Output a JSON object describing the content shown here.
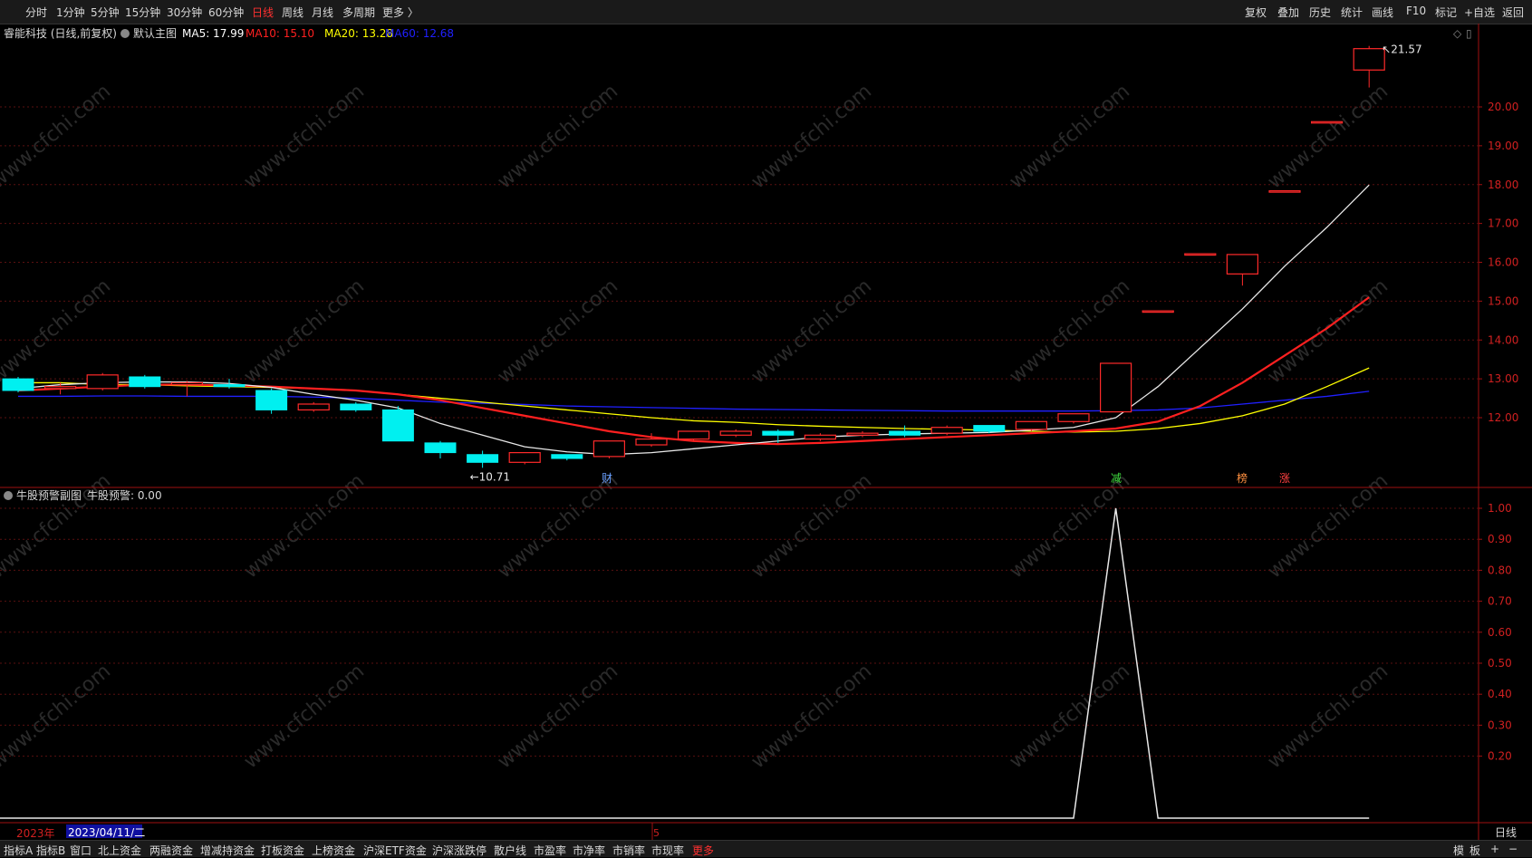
{
  "toolbar": {
    "left": [
      "分时",
      "1分钟",
      "5分钟",
      "15分钟",
      "30分钟",
      "60分钟",
      "日线",
      "周线",
      "月线",
      "多周期",
      "更多 〉"
    ],
    "active": "日线",
    "right": [
      "复权",
      "叠加",
      "历史",
      "统计",
      "画线",
      "F10",
      "标记",
      "+自选",
      "返回"
    ]
  },
  "main_chart": {
    "title": "睿能科技 (日线,前复权)",
    "formula": "默认主图",
    "ma": [
      {
        "label": "MA5: 17.99",
        "color": "#ffffff"
      },
      {
        "label": "MA10: 15.10",
        "color": "#ff2020"
      },
      {
        "label": "MA20: 13.28",
        "color": "#ffff00"
      },
      {
        "label": "MA60: 12.68",
        "color": "#2020ff"
      }
    ],
    "high_label": "21.57",
    "low_label": "10.71",
    "event_markers": [
      {
        "text": "财",
        "color": "#6aa0ff"
      },
      {
        "text": "减",
        "color": "#40e040"
      },
      {
        "text": "榜",
        "color": "#ff9040"
      },
      {
        "text": "涨",
        "color": "#ff4040"
      }
    ]
  },
  "sub_chart": {
    "title": "牛股预警副图",
    "value_label": "牛股预警: 0.00"
  },
  "timeline": {
    "year": "2023年",
    "cursor_date": "2023/04/11/二",
    "mid_label": "5"
  },
  "watermark": "www.cfchi.com",
  "period_label": "日线",
  "bottom": {
    "items": [
      "指标A",
      "指标B",
      "窗口",
      "北上资金",
      "两融资金",
      "增减持资金",
      "打板资金",
      "上榜资金",
      "沪深ETF资金",
      "沪深涨跌停",
      "散户线",
      "市盈率",
      "市净率",
      "市销率",
      "市现率",
      "更多"
    ],
    "right": [
      "模",
      "板",
      "+",
      "−"
    ]
  },
  "chart_data": [
    {
      "type": "candlestick",
      "title": "睿能科技 (日线,前复权)",
      "ylim": [
        11.0,
        22.0
      ],
      "yticks": [
        "20.00",
        "19.00",
        "18.00",
        "17.00",
        "16.00",
        "15.00",
        "14.00",
        "13.00",
        "12.00"
      ],
      "candles": [
        {
          "o": 12.7,
          "c": 13.0,
          "h": 13.05,
          "l": 12.65,
          "up": false
        },
        {
          "o": 12.75,
          "c": 12.8,
          "h": 12.9,
          "l": 12.6,
          "up": true
        },
        {
          "o": 12.75,
          "c": 13.1,
          "h": 13.15,
          "l": 12.7,
          "up": true
        },
        {
          "o": 12.8,
          "c": 13.05,
          "h": 13.1,
          "l": 12.75,
          "up": false
        },
        {
          "o": 12.85,
          "c": 12.9,
          "h": 12.95,
          "l": 12.55,
          "up": true
        },
        {
          "o": 12.8,
          "c": 12.85,
          "h": 13.0,
          "l": 12.75,
          "up": false
        },
        {
          "o": 12.7,
          "c": 12.2,
          "h": 12.75,
          "l": 12.1,
          "up": false
        },
        {
          "o": 12.2,
          "c": 12.35,
          "h": 12.4,
          "l": 12.15,
          "up": true
        },
        {
          "o": 12.35,
          "c": 12.2,
          "h": 12.4,
          "l": 12.15,
          "up": false
        },
        {
          "o": 12.2,
          "c": 11.4,
          "h": 12.3,
          "l": 11.4,
          "up": false
        },
        {
          "o": 11.35,
          "c": 11.1,
          "h": 11.4,
          "l": 10.95,
          "up": false
        },
        {
          "o": 11.05,
          "c": 10.85,
          "h": 11.15,
          "l": 10.71,
          "up": false
        },
        {
          "o": 10.85,
          "c": 11.1,
          "h": 11.1,
          "l": 10.8,
          "up": true
        },
        {
          "o": 11.05,
          "c": 10.95,
          "h": 11.05,
          "l": 10.9,
          "up": false
        },
        {
          "o": 11.0,
          "c": 11.4,
          "h": 11.4,
          "l": 10.95,
          "up": true
        },
        {
          "o": 11.3,
          "c": 11.45,
          "h": 11.6,
          "l": 11.25,
          "up": true
        },
        {
          "o": 11.45,
          "c": 11.65,
          "h": 11.65,
          "l": 11.4,
          "up": true
        },
        {
          "o": 11.55,
          "c": 11.65,
          "h": 11.7,
          "l": 11.5,
          "up": true
        },
        {
          "o": 11.65,
          "c": 11.55,
          "h": 11.7,
          "l": 11.35,
          "up": false
        },
        {
          "o": 11.45,
          "c": 11.55,
          "h": 11.6,
          "l": 11.4,
          "up": true
        },
        {
          "o": 11.55,
          "c": 11.6,
          "h": 11.65,
          "l": 11.5,
          "up": true
        },
        {
          "o": 11.65,
          "c": 11.55,
          "h": 11.8,
          "l": 11.5,
          "up": false
        },
        {
          "o": 11.6,
          "c": 11.75,
          "h": 11.8,
          "l": 11.55,
          "up": true
        },
        {
          "o": 11.8,
          "c": 11.65,
          "h": 11.8,
          "l": 11.6,
          "up": false
        },
        {
          "o": 11.7,
          "c": 11.9,
          "h": 11.9,
          "l": 11.65,
          "up": true
        },
        {
          "o": 11.9,
          "c": 12.1,
          "h": 12.1,
          "l": 11.85,
          "up": true
        },
        {
          "o": 12.15,
          "c": 13.4,
          "h": 13.4,
          "l": 12.15,
          "up": true
        },
        {
          "o": 14.75,
          "c": 14.75,
          "h": 14.75,
          "l": 14.75,
          "up": true
        },
        {
          "o": 16.22,
          "c": 16.22,
          "h": 16.22,
          "l": 16.22,
          "up": true
        },
        {
          "o": 15.7,
          "c": 16.2,
          "h": 16.2,
          "l": 15.4,
          "up": true
        },
        {
          "o": 17.84,
          "c": 17.84,
          "h": 17.84,
          "l": 17.84,
          "up": true
        },
        {
          "o": 19.62,
          "c": 19.62,
          "h": 19.62,
          "l": 19.62,
          "up": true
        },
        {
          "o": 20.95,
          "c": 21.5,
          "h": 21.57,
          "l": 20.5,
          "up": true
        }
      ],
      "series": [
        {
          "name": "MA5",
          "color": "#e8e8e8",
          "values": [
            12.75,
            12.85,
            12.9,
            12.92,
            12.92,
            12.88,
            12.78,
            12.6,
            12.45,
            12.25,
            11.85,
            11.55,
            11.25,
            11.12,
            11.05,
            11.1,
            11.2,
            11.3,
            11.4,
            11.5,
            11.55,
            11.58,
            11.6,
            11.62,
            11.68,
            11.75,
            12.0,
            12.8,
            13.8,
            14.8,
            15.9,
            16.9,
            17.99
          ]
        },
        {
          "name": "MA10",
          "color": "#ff2020",
          "values": [
            12.7,
            12.75,
            12.8,
            12.85,
            12.85,
            12.83,
            12.8,
            12.75,
            12.7,
            12.6,
            12.45,
            12.25,
            12.05,
            11.85,
            11.65,
            11.5,
            11.4,
            11.35,
            11.32,
            11.35,
            11.4,
            11.45,
            11.5,
            11.55,
            11.6,
            11.65,
            11.72,
            11.9,
            12.3,
            12.9,
            13.6,
            14.3,
            15.1
          ]
        },
        {
          "name": "MA20",
          "color": "#ffff00",
          "values": [
            12.9,
            12.9,
            12.85,
            12.85,
            12.82,
            12.8,
            12.78,
            12.75,
            12.7,
            12.6,
            12.5,
            12.4,
            12.3,
            12.2,
            12.1,
            12.0,
            11.92,
            11.88,
            11.82,
            11.78,
            11.75,
            11.72,
            11.7,
            11.68,
            11.65,
            11.63,
            11.65,
            11.72,
            11.85,
            12.05,
            12.35,
            12.8,
            13.28
          ]
        },
        {
          "name": "MA60",
          "color": "#2020ff",
          "values": [
            12.55,
            12.55,
            12.56,
            12.56,
            12.55,
            12.55,
            12.55,
            12.53,
            12.5,
            12.45,
            12.4,
            12.37,
            12.34,
            12.3,
            12.28,
            12.26,
            12.24,
            12.22,
            12.21,
            12.2,
            12.19,
            12.18,
            12.17,
            12.17,
            12.17,
            12.17,
            12.18,
            12.2,
            12.25,
            12.35,
            12.45,
            12.55,
            12.68
          ]
        }
      ]
    },
    {
      "type": "line",
      "title": "牛股预警副图",
      "ylim": [
        0,
        1.05
      ],
      "yticks": [
        "1.00",
        "0.90",
        "0.80",
        "0.70",
        "0.60",
        "0.50",
        "0.40",
        "0.30",
        "0.20"
      ],
      "series": [
        {
          "name": "牛股预警",
          "color": "#e8e8e8",
          "values": [
            0,
            0,
            0,
            0,
            0,
            0,
            0,
            0,
            0,
            0,
            0,
            0,
            0,
            0,
            0,
            0,
            0,
            0,
            0,
            0,
            0,
            0,
            0,
            0,
            0,
            0,
            1,
            0,
            0,
            0,
            0,
            0,
            0
          ]
        }
      ]
    }
  ]
}
